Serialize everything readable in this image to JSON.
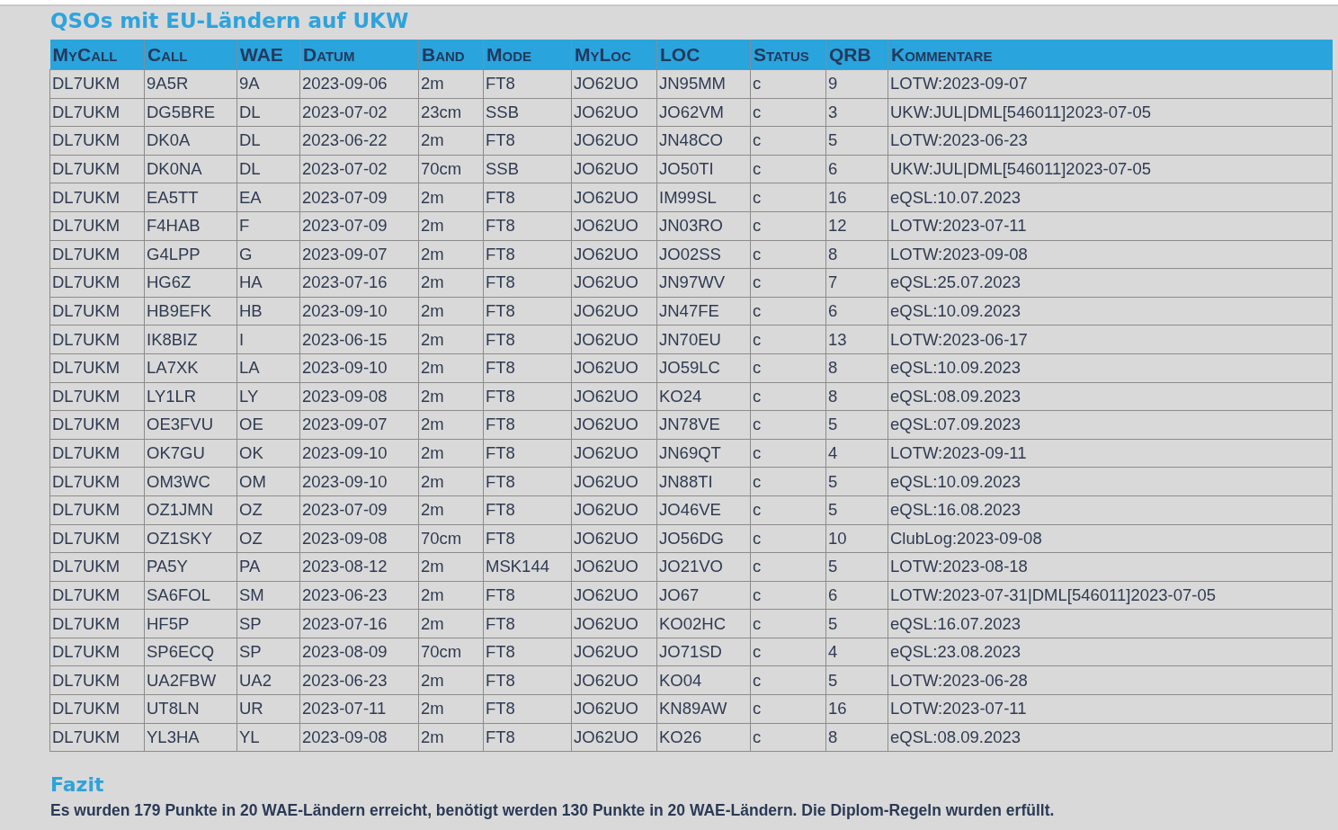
{
  "title": "QSOs mit EU-Ländern auf UKW",
  "table": {
    "columns": [
      "MyCall",
      "Call",
      "WAE",
      "Datum",
      "Band",
      "Mode",
      "MyLoc",
      "LOC",
      "Status",
      "QRB",
      "Kommentare"
    ],
    "rows": [
      [
        "DL7UKM",
        "9A5R",
        "9A",
        "2023-09-06",
        "2m",
        "FT8",
        "JO62UO",
        "JN95MM",
        "c",
        "9",
        "LOTW:2023-09-07"
      ],
      [
        "DL7UKM",
        "DG5BRE",
        "DL",
        "2023-07-02",
        "23cm",
        "SSB",
        "JO62UO",
        "JO62VM",
        "c",
        "3",
        "UKW:JUL|DML[546011]2023-07-05"
      ],
      [
        "DL7UKM",
        "DK0A",
        "DL",
        "2023-06-22",
        "2m",
        "FT8",
        "JO62UO",
        "JN48CO",
        "c",
        "5",
        "LOTW:2023-06-23"
      ],
      [
        "DL7UKM",
        "DK0NA",
        "DL",
        "2023-07-02",
        "70cm",
        "SSB",
        "JO62UO",
        "JO50TI",
        "c",
        "6",
        "UKW:JUL|DML[546011]2023-07-05"
      ],
      [
        "DL7UKM",
        "EA5TT",
        "EA",
        "2023-07-09",
        "2m",
        "FT8",
        "JO62UO",
        "IM99SL",
        "c",
        "16",
        "eQSL:10.07.2023"
      ],
      [
        "DL7UKM",
        "F4HAB",
        "F",
        "2023-07-09",
        "2m",
        "FT8",
        "JO62UO",
        "JN03RO",
        "c",
        "12",
        "LOTW:2023-07-11"
      ],
      [
        "DL7UKM",
        "G4LPP",
        "G",
        "2023-09-07",
        "2m",
        "FT8",
        "JO62UO",
        "JO02SS",
        "c",
        "8",
        "LOTW:2023-09-08"
      ],
      [
        "DL7UKM",
        "HG6Z",
        "HA",
        "2023-07-16",
        "2m",
        "FT8",
        "JO62UO",
        "JN97WV",
        "c",
        "7",
        "eQSL:25.07.2023"
      ],
      [
        "DL7UKM",
        "HB9EFK",
        "HB",
        "2023-09-10",
        "2m",
        "FT8",
        "JO62UO",
        "JN47FE",
        "c",
        "6",
        "eQSL:10.09.2023"
      ],
      [
        "DL7UKM",
        "IK8BIZ",
        "I",
        "2023-06-15",
        "2m",
        "FT8",
        "JO62UO",
        "JN70EU",
        "c",
        "13",
        "LOTW:2023-06-17"
      ],
      [
        "DL7UKM",
        "LA7XK",
        "LA",
        "2023-09-10",
        "2m",
        "FT8",
        "JO62UO",
        "JO59LC",
        "c",
        "8",
        "eQSL:10.09.2023"
      ],
      [
        "DL7UKM",
        "LY1LR",
        "LY",
        "2023-09-08",
        "2m",
        "FT8",
        "JO62UO",
        "KO24",
        "c",
        "8",
        "eQSL:08.09.2023"
      ],
      [
        "DL7UKM",
        "OE3FVU",
        "OE",
        "2023-09-07",
        "2m",
        "FT8",
        "JO62UO",
        "JN78VE",
        "c",
        "5",
        "eQSL:07.09.2023"
      ],
      [
        "DL7UKM",
        "OK7GU",
        "OK",
        "2023-09-10",
        "2m",
        "FT8",
        "JO62UO",
        "JN69QT",
        "c",
        "4",
        "LOTW:2023-09-11"
      ],
      [
        "DL7UKM",
        "OM3WC",
        "OM",
        "2023-09-10",
        "2m",
        "FT8",
        "JO62UO",
        "JN88TI",
        "c",
        "5",
        "eQSL:10.09.2023"
      ],
      [
        "DL7UKM",
        "OZ1JMN",
        "OZ",
        "2023-07-09",
        "2m",
        "FT8",
        "JO62UO",
        "JO46VE",
        "c",
        "5",
        "eQSL:16.08.2023"
      ],
      [
        "DL7UKM",
        "OZ1SKY",
        "OZ",
        "2023-09-08",
        "70cm",
        "FT8",
        "JO62UO",
        "JO56DG",
        "c",
        "10",
        "ClubLog:2023-09-08"
      ],
      [
        "DL7UKM",
        "PA5Y",
        "PA",
        "2023-08-12",
        "2m",
        "MSK144",
        "JO62UO",
        "JO21VO",
        "c",
        "5",
        "LOTW:2023-08-18"
      ],
      [
        "DL7UKM",
        "SA6FOL",
        "SM",
        "2023-06-23",
        "2m",
        "FT8",
        "JO62UO",
        "JO67",
        "c",
        "6",
        "LOTW:2023-07-31|DML[546011]2023-07-05"
      ],
      [
        "DL7UKM",
        "HF5P",
        "SP",
        "2023-07-16",
        "2m",
        "FT8",
        "JO62UO",
        "KO02HC",
        "c",
        "5",
        "eQSL:16.07.2023"
      ],
      [
        "DL7UKM",
        "SP6ECQ",
        "SP",
        "2023-08-09",
        "70cm",
        "FT8",
        "JO62UO",
        "JO71SD",
        "c",
        "4",
        "eQSL:23.08.2023"
      ],
      [
        "DL7UKM",
        "UA2FBW",
        "UA2",
        "2023-06-23",
        "2m",
        "FT8",
        "JO62UO",
        "KO04",
        "c",
        "5",
        "LOTW:2023-06-28"
      ],
      [
        "DL7UKM",
        "UT8LN",
        "UR",
        "2023-07-11",
        "2m",
        "FT8",
        "JO62UO",
        "KN89AW",
        "c",
        "16",
        "LOTW:2023-07-11"
      ],
      [
        "DL7UKM",
        "YL3HA",
        "YL",
        "2023-09-08",
        "2m",
        "FT8",
        "JO62UO",
        "KO26",
        "c",
        "8",
        "eQSL:08.09.2023"
      ]
    ]
  },
  "summary": {
    "heading": "Fazit",
    "text": "Es wurden 179 Punkte in 20 WAE-Ländern erreicht, benötigt werden 130 Punkte in 20 WAE-Ländern. Die Diplom-Regeln wurden erfüllt."
  }
}
